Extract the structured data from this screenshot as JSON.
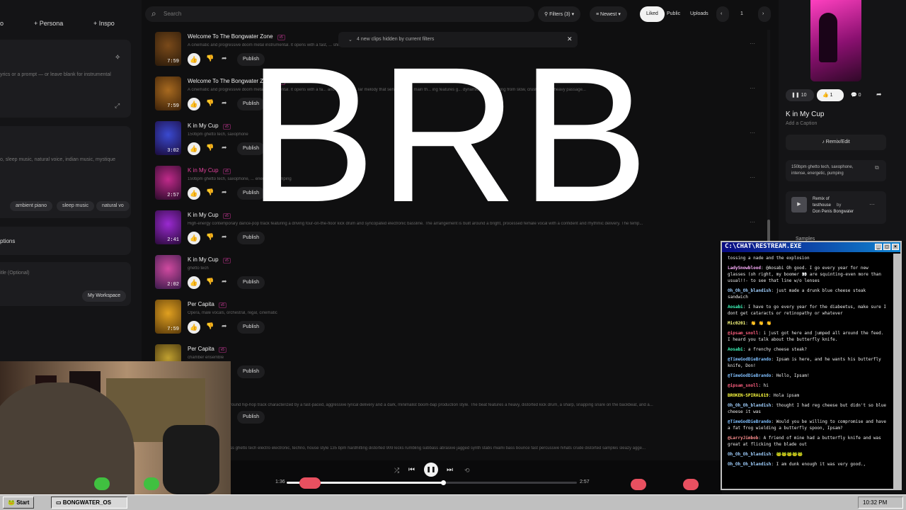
{
  "left_panel": {
    "tabs": [
      "o",
      "Persona",
      "Inspo"
    ],
    "lyrics_placeholder": "yrics or a prompt — or leave blank for instrumental",
    "style_hint": "o, sleep music, natural voice, indian music, mystique",
    "style_tags": [
      "ambient piano",
      "sleep music",
      "natural vo"
    ],
    "options_label": "ptions",
    "title_placeholder": "itle (Optional)",
    "workspace_button": "My Workspace"
  },
  "toolbar": {
    "search_placeholder": "Search",
    "filters_label": "Filters (3)",
    "sort_label": "Newest",
    "liked_label": "Liked",
    "public_label": "Public",
    "uploads_label": "Uploads",
    "page_number": "1"
  },
  "notice": {
    "text": "4 new clips hidden by current filters"
  },
  "overlay": {
    "text": "BRB"
  },
  "clips": [
    {
      "title": "Welcome To The Bongwater Zone",
      "version": "v5",
      "duration": "7:59",
      "desc": "A cinematic and progressive doom metal instrumental. It opens with a fast, ... shifts, moving from slow, crushing, and heavy passage...",
      "publish": "Publish",
      "color1": "#7a4a1a",
      "color2": "#2a1a0a"
    },
    {
      "title": "Welcome To The Bongwater Zone",
      "version": "v5",
      "duration": "7:59",
      "desc": "A cinematic and progressive doom metal instrumental. It opens with a fa... and heavily di... lar melody that serves as the main th... ing features g... dynamic shifts, moving from slow, crushing, and heavy passage...",
      "publish": "Publish",
      "color1": "#a86a20",
      "color2": "#3a2008"
    },
    {
      "title": "K in My Cup",
      "version": "v5",
      "duration": "3:02",
      "desc": "150bpm ghetto tech, saxophone",
      "publish": "Publish",
      "color1": "#3a4ad0",
      "color2": "#1a0a3a"
    },
    {
      "title": "K in My Cup",
      "version": "v5",
      "duration": "2:57",
      "desc": "150bpm ghetto tech, saxophone, ... energetic, pumping",
      "publish": "Publish",
      "color1": "#c02a8a",
      "color2": "#2a0a2a",
      "active": true
    },
    {
      "title": "K in My Cup",
      "version": "v5",
      "duration": "2:41",
      "desc": "High-energy contemporary dance-pop track featuring a driving four-on-the-floor kick drum and syncopated electronic bassline. The arrangement is built around a bright, processed female vocal with a confident and rhythmic delivery. The temp...",
      "publish": "Publish",
      "color1": "#9a2ad0",
      "color2": "#2a0a3a"
    },
    {
      "title": "K in My Cup",
      "version": "v5",
      "duration": "2:02",
      "desc": "ghetto tech",
      "publish": "Publish",
      "color1": "#d04aa0",
      "color2": "#3a1a4a"
    },
    {
      "title": "Per Capita",
      "version": "v5",
      "duration": "7:59",
      "desc": "Opera, male vocals, orchestral, regal, cinematic",
      "publish": "Publish",
      "color1": "#e0a020",
      "color2": "#5a3a0a"
    },
    {
      "title": "Per Capita",
      "version": "v5",
      "duration": "",
      "desc": "chamber ensemble",
      "publish": "Publish",
      "color1": "#c0a030",
      "color2": "#3a2a0a"
    }
  ],
  "partial_rows": [
    {
      "desc": "round hip-hop track characterized by a fast-paced, aggressive lyrical delivery and a dark, minimalist boom-bap production style. The beat features a heavy, distorted kick drum, a sharp, snapping snare on the backbeat, and a...",
      "publish": "Publish"
    },
    {
      "desc": "ss ghetto tech electro electronic, techno, house style 135 bpm hardhitting distorted 909 kicks rumbling subbass abrasive jagged synth stabs miami bass bounce fast percussive hihats crude distorted samples sleazy agge..."
    }
  ],
  "player": {
    "elapsed": "1:36",
    "total": "2:57",
    "progress": 0.54
  },
  "right_panel": {
    "play_count": "10",
    "like_count": "1",
    "comment_count": "0",
    "song_title": "K in My Cup",
    "caption_placeholder": "Add a Caption",
    "remix_button": "Remix/Edit",
    "style_text": "150bpm ghetto tech, saxophone, intense, energetic, pumping",
    "remix_of_label": "Remix of",
    "remix_source": "testhouse",
    "remix_by": "by",
    "remix_artist": "Don Penis Bongwater",
    "samples_label": "Samples"
  },
  "chat": {
    "title": "C:\\CHAT\\RESTREAM.EXE",
    "messages": [
      {
        "user": "",
        "text": "tossing a nade and the explosion",
        "color": "#eee"
      },
      {
        "user": "LadySnowblood",
        "text": ": @Aosabi Oh good. I go every year for new glasses (oh right, my boomer 👀 are squinting-even more than usual!!- to see that line w/o lenses",
        "color": "#ffb0ff"
      },
      {
        "user": "Oh_Oh_Oh_blandish",
        "text": ": just made a drunk blue cheese steak sandwich",
        "color": "#a0d0ff"
      },
      {
        "user": "Aosabi",
        "text": ": I have to go every year for the diabeetus, make sure I dont get cataracts or retinopathy or whatever",
        "color": "#40ffc0"
      },
      {
        "user": "Mic0201",
        "text": ": 👏 👏 👏",
        "color": "#ffff80"
      },
      {
        "user": "@ipsam_snoll",
        "text": ": i just got here and jumped all around the feed. I heard you talk about the butterfly knife.",
        "color": "#ff6080"
      },
      {
        "user": "Aosabi",
        "text": ": a frenchy cheese steak?",
        "color": "#40ffc0"
      },
      {
        "user": "@TimeGodDieBrando",
        "text": ": Ipsam is here, and he wants his butterfly knife, Don!",
        "color": "#80c0ff"
      },
      {
        "user": "@TimeGodDieBrando",
        "text": ": Hello, Ipsam!",
        "color": "#80c0ff"
      },
      {
        "user": "@ipsam_snoll",
        "text": ": hi",
        "color": "#ff6080"
      },
      {
        "user": "BROKEN-SPIRAL619",
        "text": ": Hola ipsam",
        "color": "#ffff40"
      },
      {
        "user": "Oh_Oh_Oh_blandish",
        "text": ": thought I had reg cheese but didn't so blue cheese it was",
        "color": "#a0d0ff"
      },
      {
        "user": "@TimeGodDieBrando",
        "text": ": Would you be willing to compromise and have a fat frog wielding a butterfly spoon, Ipsam?",
        "color": "#80c0ff"
      },
      {
        "user": "@LarryJimbob",
        "text": ": A friend of mine had a butterfly knife and was great at flicking the blade out",
        "color": "#ff9090"
      },
      {
        "user": "Oh_Oh_Oh_blandish",
        "text": ": 🐸🐸🐸🐸🐸",
        "color": "#a0d0ff"
      },
      {
        "user": "Oh_Oh_Oh_blandish",
        "text": ": I am dunk enough it was very good.,",
        "color": "#a0d0ff"
      }
    ]
  },
  "taskbar": {
    "start_label": "Start",
    "task_label": "BONGWATER_OS",
    "clock": "10:32 PM"
  },
  "colors": {
    "accent_pink": "#e0409a",
    "taskbar_gray": "#c0c0c0",
    "title_blue": "#0a0a80"
  }
}
